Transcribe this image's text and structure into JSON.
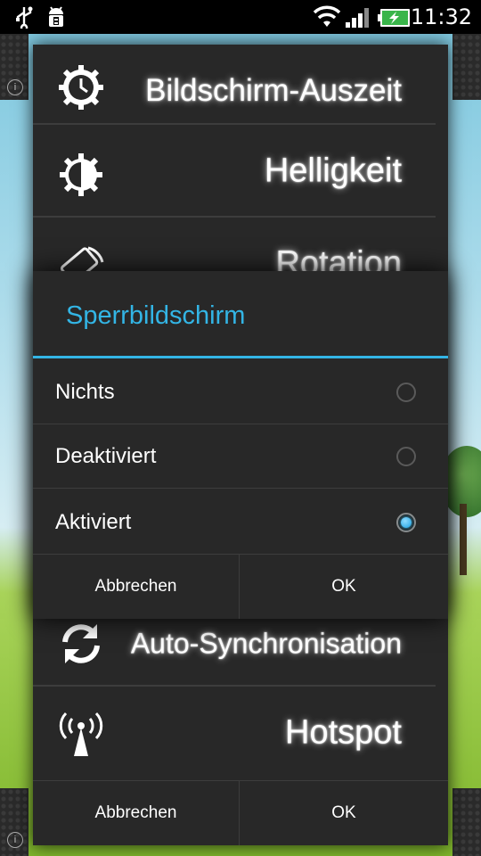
{
  "status_bar": {
    "time": "11:32",
    "icons": [
      "usb-icon",
      "android-debug-icon",
      "wifi-icon",
      "signal-icon",
      "battery-charging-icon"
    ]
  },
  "colors": {
    "accent": "#33b5e5",
    "dialog_bg": "#282828",
    "divider": "#3d3d3d"
  },
  "settings_list": {
    "items": [
      {
        "label": "Bildschirm-Auszeit",
        "icon": "clock-gear-icon"
      },
      {
        "label": "Helligkeit",
        "icon": "brightness-icon"
      },
      {
        "label": "Rotation",
        "icon": "rotation-icon"
      },
      {
        "label": "Auto-Synchronisation",
        "icon": "sync-icon"
      },
      {
        "label": "Hotspot",
        "icon": "hotspot-icon"
      }
    ],
    "cancel_label": "Abbrechen",
    "ok_label": "OK"
  },
  "lock_dialog": {
    "title": "Sperrbildschirm",
    "options": [
      {
        "label": "Nichts",
        "selected": false
      },
      {
        "label": "Deaktiviert",
        "selected": false
      },
      {
        "label": "Aktiviert",
        "selected": true
      }
    ],
    "cancel_label": "Abbrechen",
    "ok_label": "OK"
  }
}
